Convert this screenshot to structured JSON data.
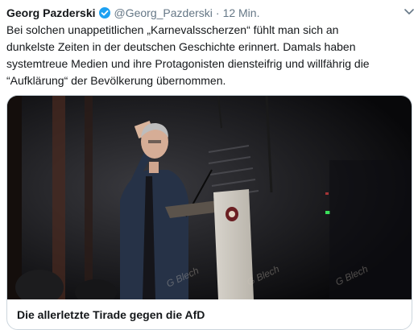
{
  "tweet": {
    "author_name": "Georg Pazderski",
    "handle": "@Georg_Pazderski",
    "separator": "·",
    "time": "12 Min.",
    "text": "Bei solchen unappetitlichen „Karnevalsscherzen“ fühlt man sich an dunkelste Zeiten in der deutschen Geschichte erinnert. Damals haben systemtreue Medien und ihre Protagonisten diensteifrig und willfährig die “Aufklärung“ der Bevölkerung übernommen.",
    "icons": {
      "verified": "verified-badge-icon",
      "menu": "chevron-down-icon"
    }
  },
  "card": {
    "title": "Die allerletzte Tirade gegen die AfD",
    "watermark": "G Blech",
    "colors": {
      "verified": "#1da1f2",
      "muted": "#657786",
      "border": "#ccd6dd"
    }
  }
}
